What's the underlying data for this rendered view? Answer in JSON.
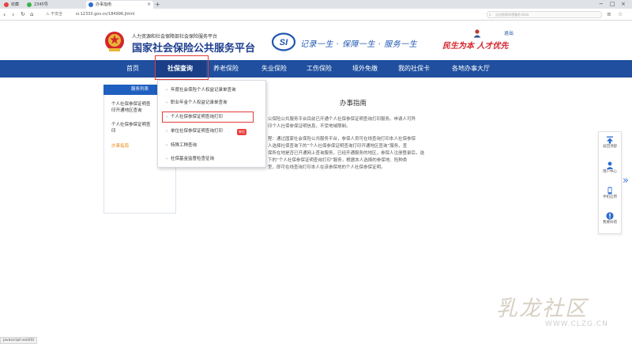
{
  "browser": {
    "tabs": [
      {
        "label": "收藏",
        "active": false
      },
      {
        "label": "2345导",
        "active": false
      },
      {
        "label": "办事指南",
        "active": true
      }
    ],
    "new_tab_symbol": "+",
    "security_label": "不安全",
    "url": "si.12333.gov.cn/184996.jhtml",
    "search_placeholder": "点击搜索你想看的 Beta",
    "window_controls": [
      "−",
      "□",
      "×"
    ]
  },
  "header": {
    "subtitle": "人力资源和社会保障部社会保险服务平台",
    "title": "国家社会保险公共服务平台",
    "si_logo_text": "SI",
    "slogan": "记录一生 · 保障一生 · 服务一生",
    "red_slogan": "民生为本  人才优先",
    "login_text": "退出",
    "logout_text": "退出"
  },
  "nav": {
    "items": [
      "首页",
      "社保查询",
      "养老保险",
      "失业保险",
      "工伤保险",
      "境外免缴",
      "我的社保卡",
      "各地办事大厅"
    ],
    "active_index": 1
  },
  "sidebar": {
    "heading": "服务列表",
    "items": [
      {
        "line1": "个人社保参保证明查",
        "line2": "印开通地区查询"
      },
      {
        "line1": "个人社保参保证明查",
        "line2": "印"
      },
      {
        "line1": "办事指南",
        "line2": ""
      }
    ]
  },
  "content": {
    "title": "办事指南",
    "paragraphs": [
      "公保险公共服务平台目前已开通个人社保参保证明查询打印服务。申请人可异",
      "印个人社保参保证明信息，不受地域限制。",
      "程：通过国家社会保险公共服务平台，参保人员可在线查询打印本人社保参保",
      "人选择社保查询下的“个人社保参保证明查询打印开通地区查询”服务，查",
      "保所在地是否已开通网上查询服务，已经开通服务的地区，参保人注册登录后，选",
      "下的“个人社保参保证明查询打印”服务，根据本人选择的参保地、险种类",
      "型，即可在线查询打印本人在该参保地的个人社保参保证明。"
    ]
  },
  "dropdown": {
    "items": [
      "年度社会保险个人权益记录单查询",
      "职业年金个人权益记录单查询",
      "个人社保参保证明查询打印",
      "单位社保参保证明查询打印",
      "特殊工种查询",
      "社保基金监督检查征询"
    ],
    "badge": "单位",
    "highlight_index": 2
  },
  "float_panel": {
    "items": [
      {
        "icon": "arrow-up-icon",
        "label": "返回顶部"
      },
      {
        "icon": "user-icon",
        "label": "用户中心"
      },
      {
        "icon": "phone-icon",
        "label": "手机应用"
      },
      {
        "icon": "exclamation-icon",
        "label": "我要纠错"
      }
    ],
    "expand_symbol": "»"
  },
  "watermark": {
    "text": "乳龙社区",
    "url": "WWW.CLZG.CN"
  },
  "status_bar": {
    "text": "javascript:void(0)"
  },
  "colors": {
    "nav_bg": "#1f4f9e",
    "title_blue": "#1e3f8f",
    "highlight_red": "#e43b3b",
    "orange_link": "#e98b1a",
    "sidebar_head": "#1f5fbf"
  }
}
